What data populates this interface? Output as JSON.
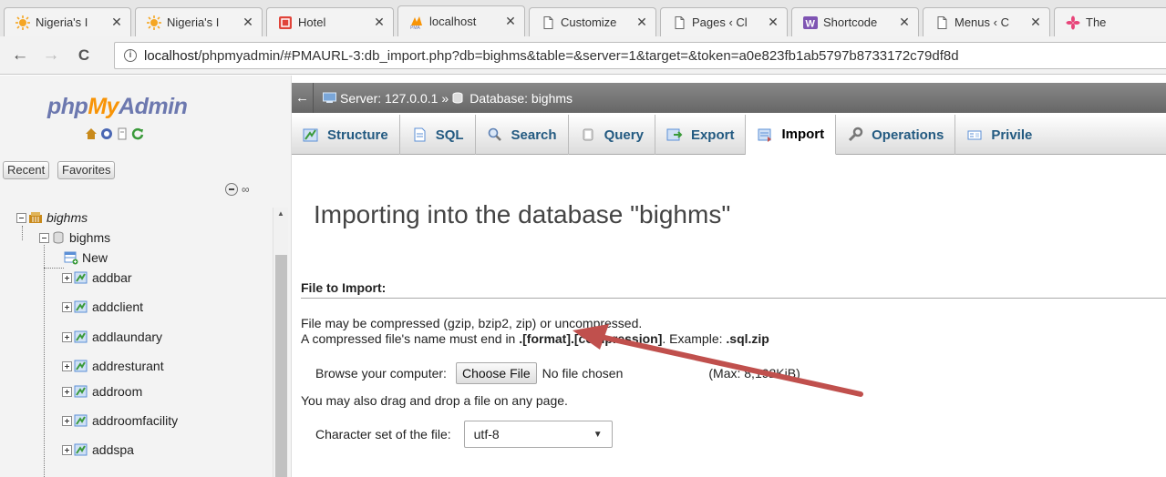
{
  "browser": {
    "tabs": [
      {
        "title": "Nigeria's I",
        "icon": "sun-logo-icon"
      },
      {
        "title": "Nigeria's I",
        "icon": "sun-logo-icon"
      },
      {
        "title": "Hotel",
        "icon": "hotel-logo-icon"
      },
      {
        "title": "localhost",
        "icon": "phpmyadmin-logo-icon",
        "active": true
      },
      {
        "title": "Customize",
        "icon": "page-icon"
      },
      {
        "title": "Pages ‹ Cl",
        "icon": "page-icon"
      },
      {
        "title": "Shortcode",
        "icon": "woocommerce-logo-icon"
      },
      {
        "title": "Menus ‹ C",
        "icon": "page-icon"
      },
      {
        "title": "The",
        "icon": "flower-logo-icon"
      }
    ],
    "close_glyph": "✕",
    "back_glyph": "←",
    "forward_glyph": "→",
    "reload_glyph": "C",
    "info_glyph": "i",
    "url_host": "localhost",
    "url_path": "/phpmyadmin/#PMAURL-3:db_import.php?db=bighms&table=&server=1&target=&token=a0e823fb1ab5797b8733172c79df8d"
  },
  "sidebar": {
    "logo": {
      "php": "php",
      "my": "My",
      "admin": "Admin"
    },
    "recent_label": "Recent",
    "favorites_label": "Favorites",
    "link_glyph": "∞",
    "tree": [
      {
        "label": "bighms",
        "italic": true,
        "level": 0,
        "type": "server"
      },
      {
        "label": "bighms",
        "level": 1,
        "type": "database"
      },
      {
        "label": "New",
        "level": 2,
        "type": "new"
      },
      {
        "label": "addbar",
        "level": 2,
        "type": "table"
      },
      {
        "label": "addclient",
        "level": 2,
        "type": "table"
      },
      {
        "label": "addlaundary",
        "level": 2,
        "type": "table"
      },
      {
        "label": "addresturant",
        "level": 2,
        "type": "table"
      },
      {
        "label": "addroom",
        "level": 2,
        "type": "table"
      },
      {
        "label": "addroomfacility",
        "level": 2,
        "type": "table"
      },
      {
        "label": "addspa",
        "level": 2,
        "type": "table"
      }
    ]
  },
  "breadcrumb": {
    "back": "←",
    "server": "Server: 127.0.0.1",
    "separator": "»",
    "database": "Database: bighms"
  },
  "menu": [
    {
      "label": "Structure",
      "icon": "structure-icon"
    },
    {
      "label": "SQL",
      "icon": "sql-icon"
    },
    {
      "label": "Search",
      "icon": "search-icon"
    },
    {
      "label": "Query",
      "icon": "query-icon"
    },
    {
      "label": "Export",
      "icon": "export-icon"
    },
    {
      "label": "Import",
      "icon": "import-icon",
      "active": true
    },
    {
      "label": "Operations",
      "icon": "operations-icon"
    },
    {
      "label": "Privile",
      "icon": "privileges-icon"
    }
  ],
  "main": {
    "title": "Importing into the database \"bighms\"",
    "section_title": "File to Import:",
    "compress_note": "File may be compressed (gzip, bzip2, zip) or uncompressed.",
    "name_note_prefix": "A compressed file's name must end in ",
    "name_note_format": ".[format].[compression]",
    "name_note_example": ". Example: ",
    "name_note_ext": ".sql.zip",
    "browse_label": "Browse your computer:",
    "choose_file": "Choose File",
    "no_file": "No file chosen",
    "max_size": "(Max: 8,192KiB)",
    "drag_note": "You may also drag and drop a file on any page.",
    "charset_label": "Character set of the file:",
    "charset_value": "utf-8",
    "caret": "▼"
  },
  "colors": {
    "annotation_arrow": "#c0504d",
    "menu_link": "#235a81",
    "logo_blue": "#6c78af",
    "logo_orange": "#f89406"
  }
}
